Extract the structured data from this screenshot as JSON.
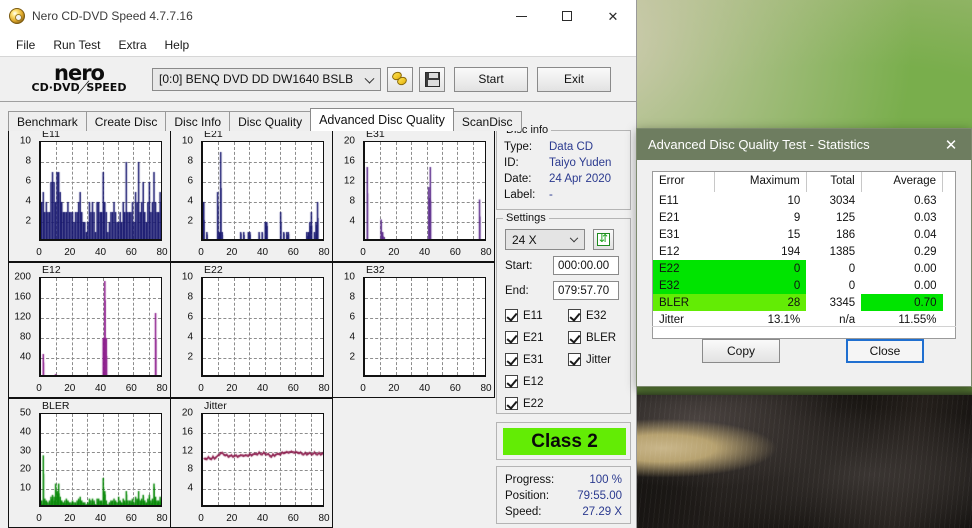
{
  "window": {
    "title": "Nero CD-DVD Speed 4.7.7.16",
    "icon": "nero-disc-icon",
    "minimize": "minimize-icon",
    "maximize": "maximize-icon",
    "close": "close-icon"
  },
  "menu": {
    "items": [
      "File",
      "Run Test",
      "Extra",
      "Help"
    ]
  },
  "toolbar": {
    "logo_line1": "nero",
    "logo_line2_a": "CD·DVD",
    "logo_line2_b": "SPEED",
    "drive": "[0:0]   BENQ DVD DD DW1640 BSLB",
    "eject_icon": "disc-eject-icon",
    "save_icon": "floppy-save-icon",
    "start_label": "Start",
    "exit_label": "Exit"
  },
  "tabs": [
    {
      "label": "Benchmark",
      "active": false
    },
    {
      "label": "Create Disc",
      "active": false
    },
    {
      "label": "Disc Info",
      "active": false
    },
    {
      "label": "Disc Quality",
      "active": false
    },
    {
      "label": "Advanced Disc Quality",
      "active": true
    },
    {
      "label": "ScanDisc",
      "active": false
    }
  ],
  "disc_info": {
    "legend": "Disc info",
    "rows": [
      {
        "key": "Type:",
        "value": "Data CD"
      },
      {
        "key": "ID:",
        "value": "Taiyo Yuden"
      },
      {
        "key": "Date:",
        "value": "24 Apr 2020"
      },
      {
        "key": "Label:",
        "value": "-"
      }
    ]
  },
  "settings": {
    "legend": "Settings",
    "speed": "24 X",
    "refresh_icon": "refresh-icon",
    "start_label": "Start:",
    "start_value": "000:00.00",
    "end_label": "End:",
    "end_value": "079:57.70",
    "checkboxes_left": [
      {
        "label": "E11",
        "checked": true
      },
      {
        "label": "E21",
        "checked": true
      },
      {
        "label": "E31",
        "checked": true
      },
      {
        "label": "E12",
        "checked": true
      },
      {
        "label": "E22",
        "checked": true
      }
    ],
    "checkboxes_right": [
      {
        "label": "E32",
        "checked": true
      },
      {
        "label": "BLER",
        "checked": true
      },
      {
        "label": "Jitter",
        "checked": true
      }
    ]
  },
  "class_badge": {
    "label": "Class 2",
    "color": "#63ec05"
  },
  "progress_panel": {
    "rows": [
      {
        "key": "Progress:",
        "value": "100 %"
      },
      {
        "key": "Position:",
        "value": "79:55.00"
      },
      {
        "key": "Speed:",
        "value": "27.29 X"
      }
    ]
  },
  "stats_dialog": {
    "title": "Advanced Disc Quality Test - Statistics",
    "close_icon": "close-icon",
    "headers": [
      "Error",
      "Maximum",
      "Total",
      "Average"
    ],
    "rows": [
      {
        "error": "E11",
        "maximum": "10",
        "total": "3034",
        "average": "0.63",
        "highlight": "none"
      },
      {
        "error": "E21",
        "maximum": "9",
        "total": "125",
        "average": "0.03",
        "highlight": "none"
      },
      {
        "error": "E31",
        "maximum": "15",
        "total": "186",
        "average": "0.04",
        "highlight": "none"
      },
      {
        "error": "E12",
        "maximum": "194",
        "total": "1385",
        "average": "0.29",
        "highlight": "none"
      },
      {
        "error": "E22",
        "maximum": "0",
        "total": "0",
        "average": "0.00",
        "highlight": "left"
      },
      {
        "error": "E32",
        "maximum": "0",
        "total": "0",
        "average": "0.00",
        "highlight": "left"
      },
      {
        "error": "BLER",
        "maximum": "28",
        "total": "3345",
        "average": "0.70",
        "highlight": "bler"
      },
      {
        "error": "Jitter",
        "maximum": "13.1%",
        "total": "n/a",
        "average": "11.55%",
        "highlight": "none"
      }
    ],
    "copy_label": "Copy",
    "close_label": "Close"
  },
  "chart_data": [
    {
      "id": "e11",
      "type": "bar",
      "title": "E11",
      "color": "#191970",
      "xlabel": "",
      "ylabel": "",
      "xlim": [
        0,
        80
      ],
      "ylim": [
        0,
        10
      ],
      "yticks": [
        2,
        4,
        6,
        8,
        10
      ],
      "xticks": [
        0,
        20,
        40,
        60,
        80
      ],
      "grid": true,
      "values": [
        4,
        5,
        3,
        4,
        3,
        3,
        6,
        7,
        6,
        4,
        7,
        7,
        5,
        4,
        3,
        3,
        3,
        4,
        3,
        3,
        3,
        2,
        3,
        3,
        4,
        5,
        3,
        2,
        2,
        1,
        2,
        4,
        3,
        4,
        3,
        1,
        4,
        4,
        3,
        3,
        7,
        4,
        3,
        1,
        2,
        3,
        3,
        4,
        3,
        2,
        2,
        3,
        2,
        4,
        3,
        8,
        3,
        3,
        3,
        4,
        2,
        5,
        4,
        8,
        3,
        4,
        6,
        3,
        2,
        4,
        6,
        3,
        4,
        7,
        4,
        3,
        3,
        5,
        4,
        1
      ]
    },
    {
      "id": "e21",
      "type": "bar",
      "title": "E21",
      "color": "#191970",
      "xlim": [
        0,
        80
      ],
      "ylim": [
        0,
        10
      ],
      "yticks": [
        2,
        4,
        6,
        8,
        10
      ],
      "xticks": [
        0,
        20,
        40,
        60,
        80
      ],
      "grid": true,
      "values": [
        4,
        0,
        1,
        0,
        0,
        0,
        0,
        0,
        0,
        5,
        1,
        9,
        1,
        0,
        0,
        0,
        0,
        0,
        0,
        0,
        0,
        0,
        0,
        0,
        1,
        0,
        1,
        0,
        0,
        1,
        1,
        0,
        0,
        0,
        0,
        0,
        1,
        0,
        1,
        0,
        2,
        2,
        0,
        0,
        0,
        0,
        0,
        0,
        0,
        0,
        3,
        0,
        1,
        0,
        1,
        1,
        0,
        0,
        0,
        0,
        0,
        0,
        0,
        0,
        0,
        0,
        0,
        1,
        1,
        2,
        3,
        0,
        1,
        2,
        4,
        0,
        0,
        0,
        0,
        0
      ]
    },
    {
      "id": "e31",
      "type": "bar",
      "title": "E31",
      "color": "#5a2a8a",
      "xlim": [
        0,
        80
      ],
      "ylim": [
        0,
        20
      ],
      "yticks": [
        4,
        8,
        12,
        16,
        20
      ],
      "xticks": [
        0,
        20,
        40,
        60,
        80
      ],
      "grid": true,
      "values": [
        0,
        15,
        0,
        0,
        0,
        0,
        0,
        0,
        0,
        0,
        4.5,
        2,
        1,
        0,
        0,
        0,
        0,
        0,
        0,
        0,
        0,
        0,
        0,
        0,
        0,
        0,
        0,
        0,
        0,
        0,
        0,
        0,
        0,
        0,
        0,
        0,
        0,
        0,
        0,
        0,
        0,
        11,
        15,
        0,
        0,
        0,
        0,
        0,
        0,
        0,
        0,
        0,
        0,
        0,
        0,
        0,
        0,
        0,
        0,
        0,
        0,
        0,
        0,
        0,
        0,
        0,
        0,
        0,
        0,
        0,
        0,
        0,
        0,
        0,
        8.5,
        0,
        0,
        0,
        0,
        0
      ]
    },
    {
      "id": "e12",
      "type": "bar",
      "title": "E12",
      "color": "#8b1a8b",
      "xlim": [
        0,
        80
      ],
      "ylim": [
        0,
        200
      ],
      "yticks": [
        40,
        80,
        120,
        160,
        200
      ],
      "xticks": [
        0,
        20,
        40,
        60,
        80
      ],
      "grid": true,
      "values": [
        0,
        48,
        4,
        0,
        0,
        0,
        0,
        0,
        0,
        8,
        3,
        2,
        0,
        0,
        0,
        0,
        0,
        0,
        0,
        0,
        0,
        0,
        0,
        0,
        0,
        0,
        0,
        0,
        0,
        0,
        0,
        0,
        0,
        0,
        0,
        0,
        0,
        0,
        0,
        0,
        80,
        194,
        80,
        0,
        0,
        0,
        0,
        0,
        0,
        0,
        0,
        0,
        0,
        0,
        0,
        0,
        0,
        0,
        0,
        0,
        0,
        0,
        0,
        0,
        0,
        0,
        0,
        0,
        0,
        0,
        0,
        0,
        0,
        0,
        130,
        4,
        0,
        0,
        0,
        0
      ]
    },
    {
      "id": "e22",
      "type": "bar",
      "title": "E22",
      "color": "#191970",
      "xlim": [
        0,
        80
      ],
      "ylim": [
        0,
        10
      ],
      "yticks": [
        2,
        4,
        6,
        8,
        10
      ],
      "xticks": [
        0,
        20,
        40,
        60,
        80
      ],
      "grid": true,
      "values": []
    },
    {
      "id": "e32",
      "type": "bar",
      "title": "E32",
      "color": "#191970",
      "xlim": [
        0,
        80
      ],
      "ylim": [
        0,
        10
      ],
      "yticks": [
        2,
        4,
        6,
        8,
        10
      ],
      "xticks": [
        0,
        20,
        40,
        60,
        80
      ],
      "grid": true,
      "values": []
    },
    {
      "id": "bler",
      "type": "bar",
      "title": "BLER",
      "color": "#0a8a0a",
      "xlim": [
        0,
        80
      ],
      "ylim": [
        0,
        50
      ],
      "yticks": [
        10,
        20,
        30,
        40,
        50
      ],
      "xticks": [
        0,
        20,
        40,
        60,
        80
      ],
      "grid": true,
      "values": [
        4,
        28,
        5,
        4,
        3,
        4,
        6,
        7,
        6,
        13,
        9,
        13,
        6,
        4,
        3,
        4,
        5,
        4,
        3,
        3,
        4,
        3,
        3,
        4,
        5,
        6,
        4,
        3,
        3,
        2,
        3,
        5,
        4,
        5,
        4,
        2,
        5,
        5,
        4,
        4,
        16,
        9,
        4,
        2,
        3,
        4,
        4,
        5,
        4,
        3,
        6,
        4,
        3,
        5,
        4,
        9,
        4,
        4,
        4,
        5,
        3,
        6,
        5,
        9,
        4,
        5,
        7,
        4,
        3,
        5,
        7,
        4,
        5,
        13,
        6,
        4,
        4,
        6,
        5,
        2
      ]
    },
    {
      "id": "jitter",
      "type": "line",
      "title": "Jitter",
      "color": "#8b1a4b",
      "xlim": [
        0,
        80
      ],
      "ylim": [
        0,
        20
      ],
      "yticks": [
        4,
        8,
        12,
        16,
        20
      ],
      "xticks": [
        0,
        20,
        40,
        60,
        80
      ],
      "grid": true,
      "values": [
        10.4,
        10.6,
        10.5,
        10.7,
        10.6,
        10.5,
        10.8,
        10.6,
        10.9,
        11.0,
        11.4,
        11.8,
        11.6,
        11.5,
        11.3,
        11.2,
        11.0,
        11.2,
        11.1,
        11.0,
        11.2,
        11.1,
        11.0,
        11.2,
        11.1,
        11.3,
        11.2,
        11.1,
        11.3,
        11.2,
        11.4,
        11.3,
        11.5,
        11.4,
        11.6,
        11.5,
        11.7,
        11.6,
        11.5,
        11.7,
        11.6,
        11.5,
        11.4,
        11.2,
        11.0,
        11.3,
        11.2,
        11.5,
        11.4,
        11.6,
        11.5,
        11.7,
        11.8,
        11.9,
        11.8,
        11.9,
        12.0,
        11.9,
        12.0,
        11.9,
        11.8,
        11.9,
        11.8,
        11.7,
        11.6,
        11.5,
        11.6,
        11.5,
        11.7,
        11.6,
        11.5,
        11.6,
        11.7,
        11.6,
        11.5,
        11.6,
        11.5,
        11.7,
        11.6,
        11.5
      ]
    }
  ]
}
